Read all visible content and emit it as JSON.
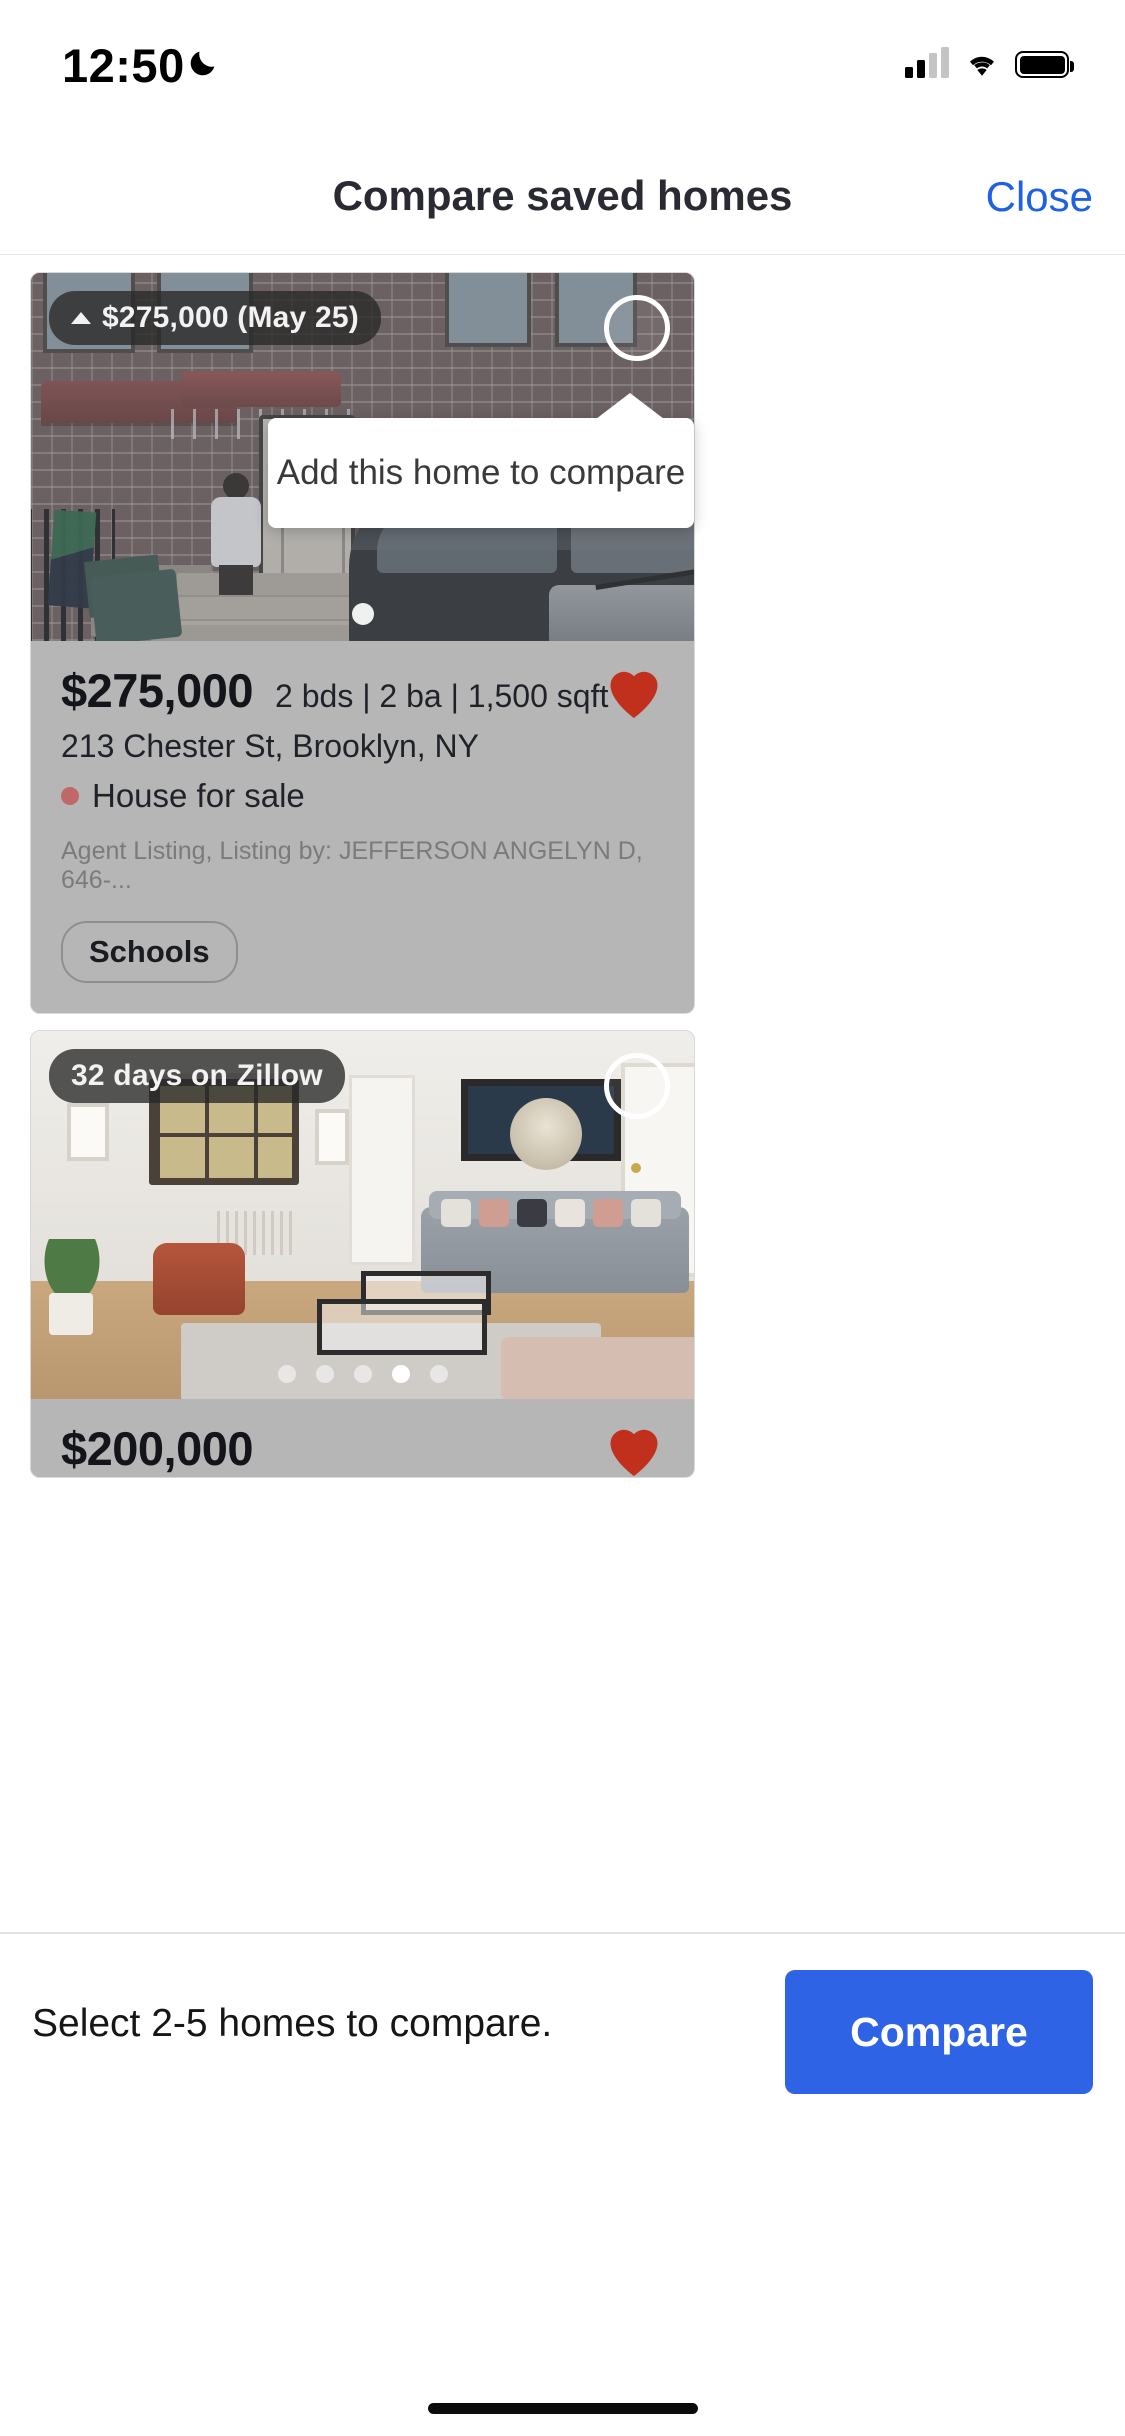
{
  "status_bar": {
    "time": "12:50",
    "dnd_icon": "moon-icon",
    "cellular_icon": "signal-bars-icon",
    "wifi_icon": "wifi-icon",
    "battery_icon": "battery-icon"
  },
  "header": {
    "title": "Compare saved homes",
    "close_label": "Close"
  },
  "tooltip": {
    "text": "Add this home to compare"
  },
  "cards": [
    {
      "badge": "$275,000 (May 25)",
      "badge_caret": "▲",
      "price": "$275,000",
      "facts": "2 bds | 2 ba | 1,500 sqft",
      "address": "213 Chester St, Brooklyn, NY",
      "status": "House for sale",
      "status_dot_color": "#c06868",
      "agent": "Agent Listing, Listing by: JEFFERSON ANGELYN D, 646-...",
      "schools_label": "Schools",
      "saved": true,
      "selected": false,
      "photo_dots": 1,
      "photo_active_dot": 0
    },
    {
      "badge": "32 days on Zillow",
      "price": "$200,000",
      "saved": true,
      "selected": false,
      "photo_dots": 5,
      "photo_active_dot": 3
    }
  ],
  "bottom_bar": {
    "message": "Select 2-5 homes to compare.",
    "compare_label": "Compare",
    "compare_color": "#2f63e5"
  }
}
